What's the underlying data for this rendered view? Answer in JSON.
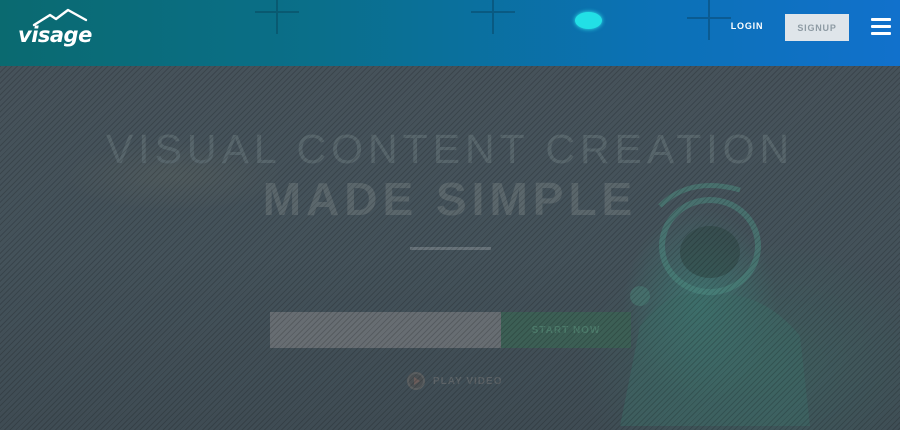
{
  "header": {
    "logo_text": "visage",
    "login_label": "LOGIN",
    "signup_label": "SIGNUP"
  },
  "hero": {
    "title_line1": "VISUAL CONTENT CREATION",
    "title_line2": "MADE SIMPLE",
    "email_placeholder": "",
    "start_label": "START NOW",
    "play_label": "PLAY VIDEO"
  },
  "icons": {
    "logo": "mountain-logo-icon",
    "menu": "hamburger-menu-icon",
    "play": "play-circle-icon"
  },
  "colors": {
    "header_gradient_start": "#0a6a70",
    "header_gradient_end": "#1171cc",
    "signup_bg": "#dfe5ea",
    "accent_blob": "#22e0e6",
    "start_button_bg": "#3c5f55"
  }
}
